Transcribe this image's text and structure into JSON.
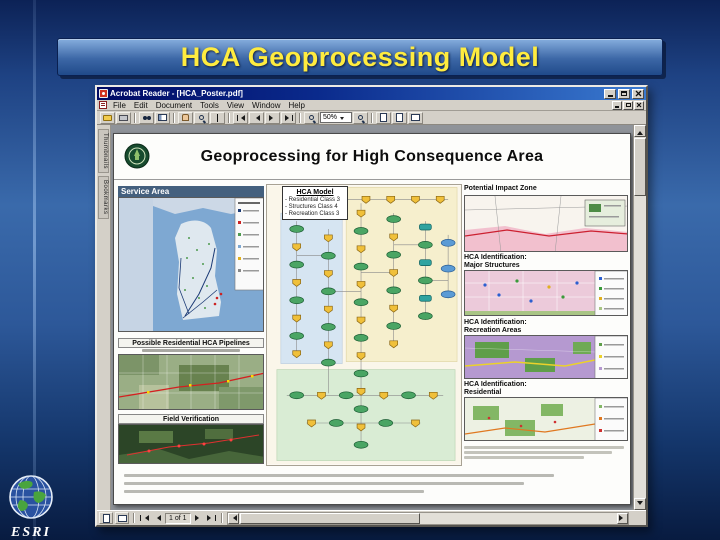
{
  "slide": {
    "title": "HCA Geoprocessing Model"
  },
  "acrobat": {
    "window_title": "Acrobat Reader - [HCA_Poster.pdf]",
    "menus": [
      "File",
      "Edit",
      "Document",
      "Tools",
      "View",
      "Window",
      "Help"
    ],
    "toolbar": {
      "zoom_value": "50%"
    },
    "nav_tabs": [
      "Thumbnails",
      "Bookmarks"
    ],
    "statusbar": {
      "page_info": "1 of 1"
    }
  },
  "poster": {
    "title": "Geoprocessing for High Consequence Area",
    "model_box": {
      "title": "HCA Model",
      "line1": "- Residential Class 3",
      "line2": "- Structures Class 4",
      "line3": "- Recreation Class 3"
    },
    "panels": {
      "service_area": "Service Area",
      "impact_zone": "Potential Impact Zone",
      "major_structures_line1": "HCA Identification:",
      "major_structures_line2": "Major Structures",
      "recreation_line1": "HCA Identification:",
      "recreation_line2": "Recreation Areas",
      "residential_line1": "HCA Identification:",
      "residential_line2": "Residential",
      "pipelines": "Possible Residential HCA Pipelines",
      "field_verification": "Field Verification"
    }
  },
  "branding": {
    "esri": "ESRI"
  }
}
